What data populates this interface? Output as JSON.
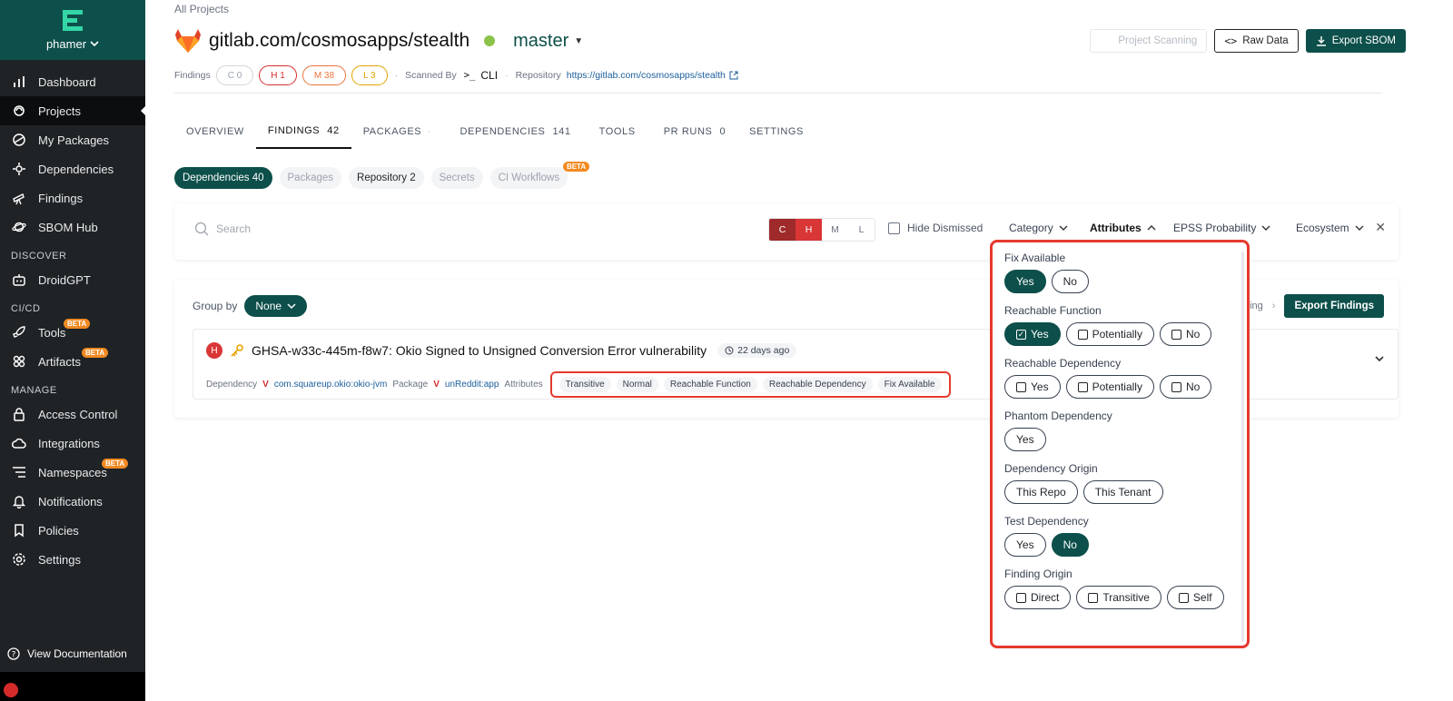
{
  "sidebar": {
    "user": "phamer",
    "items": [
      {
        "label": "Dashboard",
        "icon": "bar-chart-icon"
      },
      {
        "label": "Projects",
        "icon": "projects-icon",
        "active": true
      },
      {
        "label": "My Packages",
        "icon": "package-icon"
      },
      {
        "label": "Dependencies",
        "icon": "dependencies-icon"
      },
      {
        "label": "Findings",
        "icon": "telescope-icon"
      },
      {
        "label": "SBOM Hub",
        "icon": "planet-icon"
      }
    ],
    "discover_label": "DISCOVER",
    "discover_items": [
      {
        "label": "DroidGPT",
        "icon": "robot-icon"
      }
    ],
    "cicd_label": "CI/CD",
    "cicd_items": [
      {
        "label": "Tools",
        "icon": "rocket-icon",
        "badge": "BETA"
      },
      {
        "label": "Artifacts",
        "icon": "artifacts-icon",
        "badge": "BETA"
      }
    ],
    "manage_label": "MANAGE",
    "manage_items": [
      {
        "label": "Access Control",
        "icon": "lock-icon"
      },
      {
        "label": "Integrations",
        "icon": "cloud-icon"
      },
      {
        "label": "Namespaces",
        "icon": "list-icon",
        "badge": "BETA"
      },
      {
        "label": "Notifications",
        "icon": "bell-icon"
      },
      {
        "label": "Policies",
        "icon": "bookmark-icon"
      },
      {
        "label": "Settings",
        "icon": "gear-icon"
      }
    ],
    "view_docs": "View Documentation"
  },
  "header": {
    "breadcrumb": "All Projects",
    "project_name": "gitlab.com/cosmosapps/stealth",
    "branch": "master",
    "project_scanning": "Project Scanning",
    "raw_data": "Raw Data",
    "export_sbom": "Export SBOM"
  },
  "meta": {
    "findings_label": "Findings",
    "c": "C 0",
    "h": "H 1",
    "m": "M 38",
    "l": "L 3",
    "scanned_by_label": "Scanned By",
    "scanner": "CLI",
    "repository_label": "Repository",
    "repository_url": "https://gitlab.com/cosmosapps/stealth"
  },
  "tabs": [
    {
      "label": "OVERVIEW",
      "count": ""
    },
    {
      "label": "FINDINGS",
      "count": "42",
      "active": true
    },
    {
      "label": "PACKAGES",
      "count": ""
    },
    {
      "label": "DEPENDENCIES",
      "count": "141"
    },
    {
      "label": "TOOLS",
      "count": ""
    },
    {
      "label": "PR RUNS",
      "count": "0"
    },
    {
      "label": "SETTINGS",
      "count": ""
    }
  ],
  "chips": {
    "dependencies": "Dependencies 40",
    "packages": "Packages",
    "repository": "Repository 2",
    "secrets": "Secrets",
    "ci_workflows": "CI Workflows",
    "beta": "BETA"
  },
  "filters": {
    "search_placeholder": "Search",
    "sev_c": "C",
    "sev_h": "H",
    "sev_m": "M",
    "sev_l": "L",
    "hide_dismissed": "Hide Dismissed",
    "category": "Category",
    "attributes": "Attributes",
    "epss": "EPSS Probability",
    "ecosystem": "Ecosystem"
  },
  "results": {
    "group_by_label": "Group by",
    "group_by_value": "None",
    "sort_label": "Finding",
    "export_findings": "Export Findings",
    "finding": {
      "severity": "H",
      "title": "GHSA-w33c-445m-f8w7: Okio Signed to Unsigned Conversion Error vulnerability",
      "age": "22 days ago",
      "dependency_label": "Dependency",
      "dependency": "com.squareup.okio:okio-jvm",
      "package_label": "Package",
      "package": "unReddit:app",
      "attributes_label": "Attributes",
      "attributes": [
        "Transitive",
        "Normal",
        "Reachable Function",
        "Reachable Dependency",
        "Fix Available"
      ]
    }
  },
  "attr_popup": {
    "fix_available": {
      "label": "Fix Available",
      "yes": "Yes",
      "no": "No"
    },
    "reachable_function": {
      "label": "Reachable Function",
      "yes": "Yes",
      "potentially": "Potentially",
      "no": "No"
    },
    "reachable_dependency": {
      "label": "Reachable Dependency",
      "yes": "Yes",
      "potentially": "Potentially",
      "no": "No"
    },
    "phantom_dependency": {
      "label": "Phantom Dependency",
      "yes": "Yes"
    },
    "dependency_origin": {
      "label": "Dependency Origin",
      "this_repo": "This Repo",
      "this_tenant": "This Tenant"
    },
    "test_dependency": {
      "label": "Test Dependency",
      "yes": "Yes",
      "no": "No"
    },
    "finding_origin": {
      "label": "Finding Origin",
      "direct": "Direct",
      "transitive": "Transitive",
      "self": "Self"
    }
  },
  "colors": {
    "brand": "#0d4f4a",
    "sidebar": "#1f2326",
    "highlight": "#e53a2d",
    "critical": "#9e2a2a",
    "high": "#d93636"
  }
}
